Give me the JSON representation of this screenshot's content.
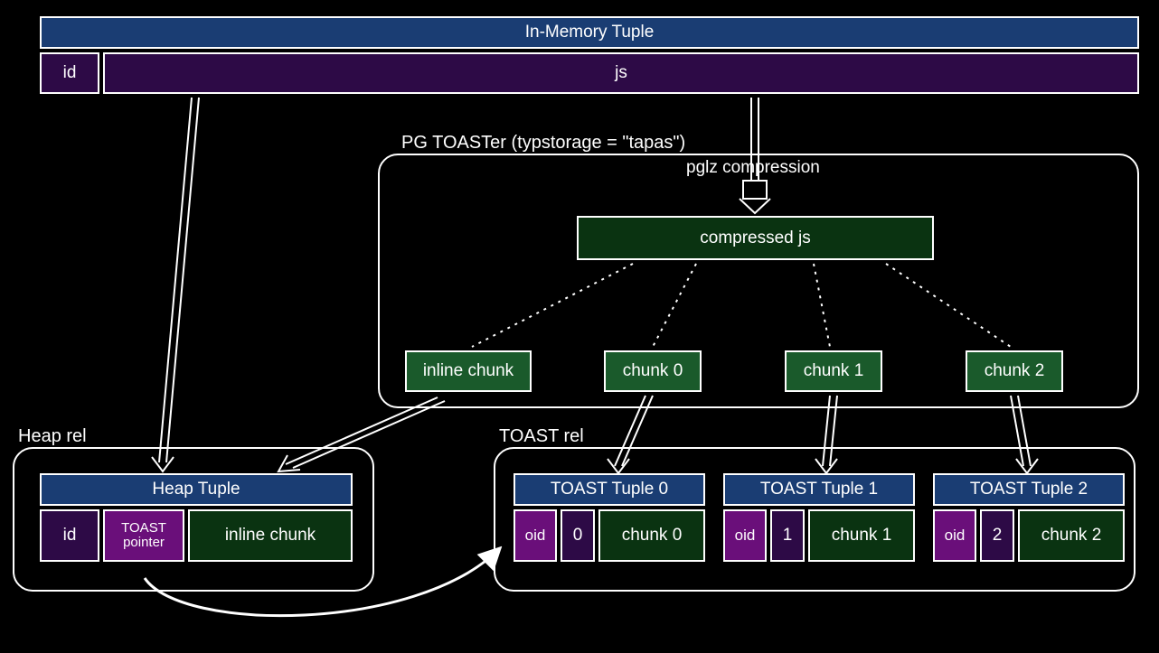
{
  "inMemoryTuple": {
    "title": "In-Memory Tuple",
    "id": "id",
    "js": "js"
  },
  "toaster": {
    "title": "PG TOASTer (typstorage = \"tapas\")",
    "compressionLabel": "pglz compression",
    "compressed": "compressed js",
    "inlineChunk": "inline chunk",
    "chunks": [
      "chunk 0",
      "chunk 1",
      "chunk 2"
    ]
  },
  "heapRel": {
    "title": "Heap rel",
    "tupleTitle": "Heap Tuple",
    "cols": {
      "id": "id",
      "pointer": "TOAST pointer",
      "inline": "inline chunk"
    }
  },
  "toastRel": {
    "title": "TOAST rel",
    "tuples": [
      {
        "title": "TOAST Tuple 0",
        "oid": "oid",
        "idx": "0",
        "chunk": "chunk 0"
      },
      {
        "title": "TOAST Tuple 1",
        "oid": "oid",
        "idx": "1",
        "chunk": "chunk 1"
      },
      {
        "title": "TOAST Tuple 2",
        "oid": "oid",
        "idx": "2",
        "chunk": "chunk 2"
      }
    ]
  }
}
